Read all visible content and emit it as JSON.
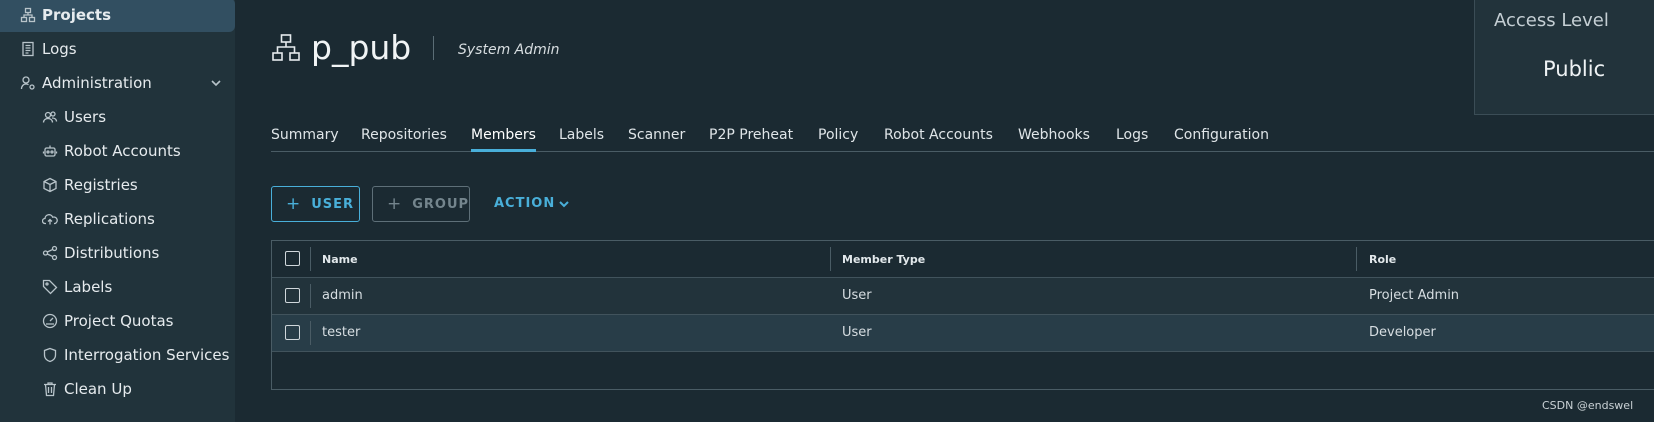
{
  "sidebar": {
    "items": [
      {
        "label": "Projects",
        "icon": "projects-icon"
      },
      {
        "label": "Logs",
        "icon": "logs-icon"
      },
      {
        "label": "Administration",
        "icon": "administration-icon"
      },
      {
        "label": "Users",
        "icon": "users-icon"
      },
      {
        "label": "Robot Accounts",
        "icon": "robot-icon"
      },
      {
        "label": "Registries",
        "icon": "registries-icon"
      },
      {
        "label": "Replications",
        "icon": "replications-icon"
      },
      {
        "label": "Distributions",
        "icon": "distributions-icon"
      },
      {
        "label": "Labels",
        "icon": "labels-icon"
      },
      {
        "label": "Project Quotas",
        "icon": "quotas-icon"
      },
      {
        "label": "Interrogation Services",
        "icon": "shield-icon"
      },
      {
        "label": "Clean Up",
        "icon": "trash-icon"
      }
    ]
  },
  "header": {
    "project_name": "p_pub",
    "role": "System Admin"
  },
  "access": {
    "title": "Access Level",
    "value": "Public"
  },
  "tabs": [
    "Summary",
    "Repositories",
    "Members",
    "Labels",
    "Scanner",
    "P2P Preheat",
    "Policy",
    "Robot Accounts",
    "Webhooks",
    "Logs",
    "Configuration"
  ],
  "active_tab": "Members",
  "actions": {
    "user_label": "USER",
    "group_label": "GROUP",
    "action_label": "ACTION"
  },
  "table": {
    "columns": [
      "Name",
      "Member Type",
      "Role"
    ],
    "rows": [
      [
        "admin",
        "User",
        "Project Admin"
      ],
      [
        "tester",
        "User",
        "Developer"
      ]
    ]
  },
  "watermark": "CSDN @endswel",
  "colors": {
    "accent": "#49afd9",
    "background": "#1b2a32",
    "sidebar": "#21333b"
  }
}
